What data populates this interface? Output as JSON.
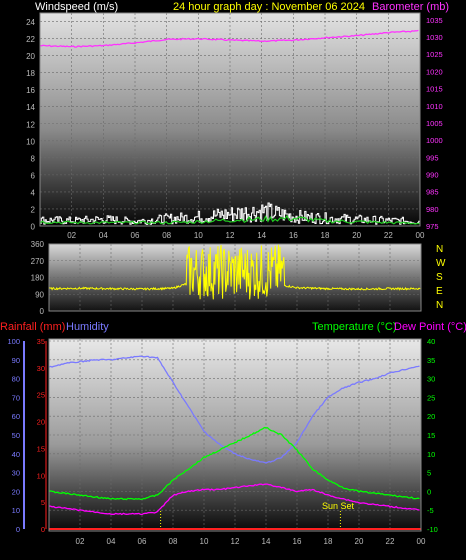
{
  "colors": {
    "background": "#000000",
    "wind": "#ffffff",
    "wind_gust": "#dddddd",
    "wind_avg": "#22cc22",
    "barometer": "#ff33ff",
    "direction": "#ffff00",
    "rain": "#ff2020",
    "humidity": "#7a7aff",
    "temperature": "#00ff00",
    "dewpoint": "#ff00ff",
    "grid": "#6a6a6a",
    "tick_label": "#bbbbbb",
    "title_yellow": "#ffff00",
    "sunset": "#ffff00"
  },
  "x_ticks": [
    "02",
    "04",
    "06",
    "08",
    "10",
    "12",
    "14",
    "16",
    "18",
    "20",
    "22",
    "00"
  ],
  "chart_data": [
    {
      "name": "wind-barometer",
      "type": "line",
      "title": "24 hour graph day : November 06 2024",
      "ylabel_left": "Windspeed (m/s)",
      "ylabel_right": "Barometer (mb)",
      "left_ticks": [
        "0",
        "2",
        "4",
        "6",
        "8",
        "10",
        "12",
        "14",
        "16",
        "18",
        "20",
        "22",
        "24"
      ],
      "right_ticks": [
        "975",
        "980",
        "985",
        "990",
        "995",
        "1000",
        "1005",
        "1010",
        "1015",
        "1020",
        "1025",
        "1030",
        "1035"
      ],
      "ylim_left": [
        0,
        25
      ],
      "ylim_right": [
        975,
        1037
      ],
      "x_hours": [
        0,
        2,
        4,
        6,
        8,
        10,
        12,
        14,
        16,
        18,
        20,
        22,
        24
      ],
      "barometer": [
        1027.5,
        1027.2,
        1027.5,
        1028.3,
        1029.3,
        1029.5,
        1029.1,
        1028.8,
        1029.1,
        1029.8,
        1030.4,
        1031.3,
        1031.8
      ],
      "wind_avg": [
        0.5,
        0.4,
        0.4,
        0.4,
        0.4,
        0.5,
        0.7,
        0.8,
        0.9,
        0.6,
        0.5,
        0.4,
        0.3
      ],
      "wind_gust": [
        1.0,
        0.9,
        1.1,
        0.8,
        1.2,
        1.5,
        2.0,
        2.5,
        1.6,
        1.3,
        1.1,
        0.9,
        0.8
      ]
    },
    {
      "name": "wind-direction",
      "type": "scatter",
      "left_ticks": [
        "0",
        "90",
        "180",
        "270",
        "360"
      ],
      "right_labels": [
        "N",
        "W",
        "S",
        "E",
        "N"
      ],
      "ylim": [
        0,
        360
      ],
      "x_hours": [
        0,
        2,
        4,
        6,
        8,
        9,
        10,
        11,
        12,
        13,
        14,
        15,
        16,
        18,
        20,
        22,
        24
      ],
      "direction": [
        120,
        122,
        120,
        118,
        122,
        150,
        200,
        230,
        210,
        220,
        190,
        140,
        125,
        120,
        118,
        120,
        120
      ]
    },
    {
      "name": "temperature-humidity-rain",
      "type": "line",
      "ylabel_left_1": "Rainfall (mm)",
      "ylabel_left_2": "Humidity",
      "ylabel_right_1": "Temperature (°C)",
      "ylabel_right_2": "Dew Point (°C)",
      "humidity_ticks": [
        "0",
        "10",
        "20",
        "30",
        "40",
        "50",
        "60",
        "70",
        "80",
        "90",
        "100"
      ],
      "rain_ticks": [
        "0",
        "5",
        "10",
        "15",
        "20",
        "25",
        "30",
        "35"
      ],
      "temp_ticks": [
        "-10",
        "-5",
        "0",
        "5",
        "10",
        "15",
        "20",
        "25",
        "30",
        "35",
        "40"
      ],
      "ylim_humidity": [
        0,
        100
      ],
      "ylim_rain": [
        0,
        35
      ],
      "ylim_temp": [
        -10,
        40
      ],
      "x_hours": [
        0,
        1,
        2,
        3,
        4,
        5,
        6,
        7,
        8,
        9,
        10,
        11,
        12,
        13,
        14,
        15,
        16,
        17,
        18,
        19,
        20,
        21,
        22,
        23,
        24
      ],
      "humidity": [
        86,
        88,
        89,
        90,
        90,
        91,
        92,
        91,
        78,
        65,
        52,
        45,
        40,
        37,
        35,
        38,
        46,
        60,
        70,
        75,
        78,
        80,
        83,
        85,
        87
      ],
      "temperature": [
        0,
        -0.5,
        -1,
        -1.5,
        -2,
        -2,
        -2,
        -1,
        3,
        6,
        9,
        11,
        13,
        15,
        17,
        15,
        11,
        6,
        3,
        1,
        0,
        -0.5,
        -1,
        -1.5,
        -2
      ],
      "dewpoint": [
        -4,
        -4.5,
        -5,
        -5.5,
        -6,
        -6,
        -6,
        -5.5,
        -1,
        0,
        0.5,
        0.5,
        1,
        1.5,
        2,
        1,
        0,
        0.5,
        -1,
        -2,
        -3,
        -3.5,
        -4,
        -4.5,
        -5
      ],
      "rain": [
        0,
        0,
        0,
        0,
        0,
        0,
        0,
        0,
        0,
        0,
        0,
        0,
        0,
        0,
        0,
        0,
        0,
        0,
        0,
        0,
        0,
        0,
        0,
        0,
        0
      ],
      "sunset_label": "Sun Set",
      "markers_hours": [
        7.2,
        18.8
      ]
    }
  ]
}
